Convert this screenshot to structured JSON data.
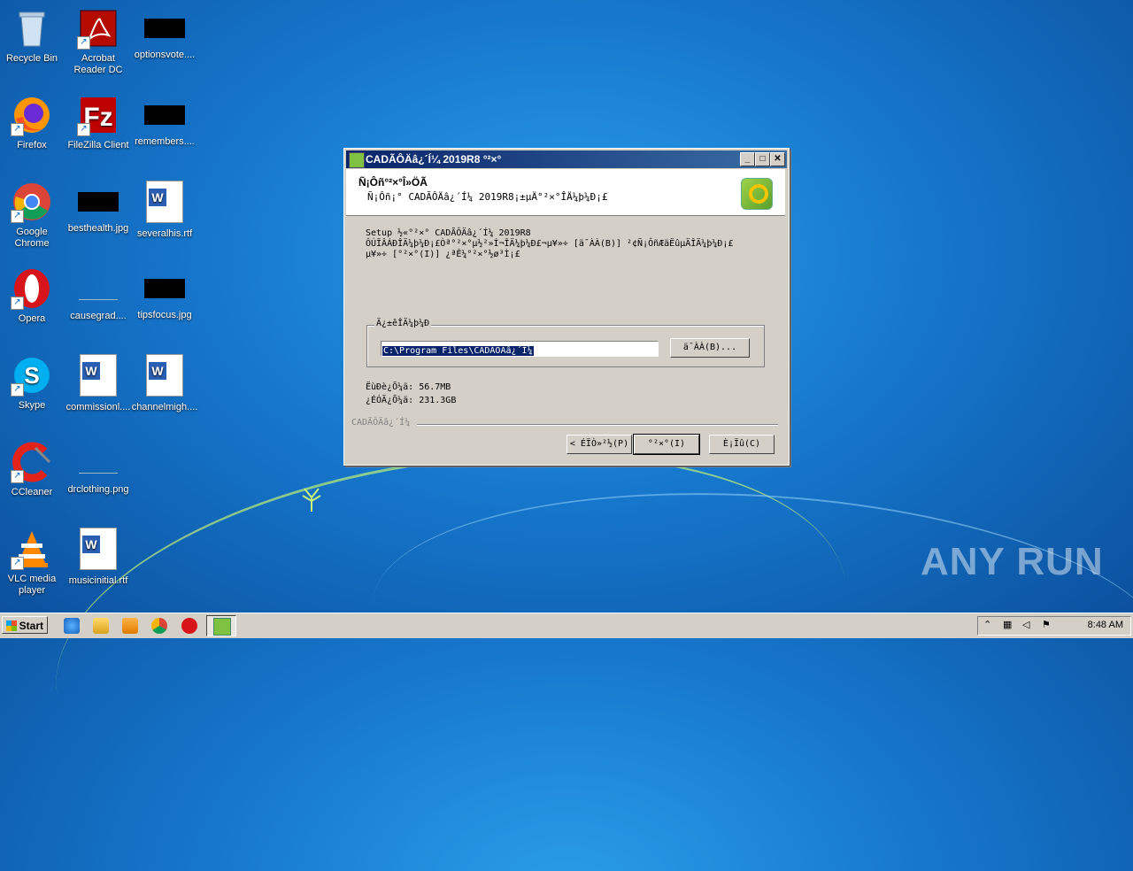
{
  "desktop": {
    "icons": [
      {
        "label": "Recycle Bin"
      },
      {
        "label": "Acrobat Reader DC"
      },
      {
        "label": "optionsvote...."
      },
      {
        "label": "Firefox"
      },
      {
        "label": "FileZilla Client"
      },
      {
        "label": "remembers...."
      },
      {
        "label": "Google Chrome"
      },
      {
        "label": "besthealth.jpg"
      },
      {
        "label": "severalhis.rtf"
      },
      {
        "label": "Opera"
      },
      {
        "label": "causegrad...."
      },
      {
        "label": "tipsfocus.jpg"
      },
      {
        "label": "Skype"
      },
      {
        "label": "commissionl...."
      },
      {
        "label": "channelmigh...."
      },
      {
        "label": "CCleaner"
      },
      {
        "label": "drclothing.png"
      },
      {
        "label": "VLC media player"
      },
      {
        "label": "musicinitial.rtf"
      }
    ],
    "watermark": "ANY RUN"
  },
  "dialog": {
    "title": "CADÃÔÄâ¿´Í¼ 2019R8 °²×°",
    "header_title": "Ñ¡Ôñ°²×°Î»ÖÃ",
    "header_subtitle": "Ñ¡Ôñ¡° CADÃÔÄâ¿´Í¼ 2019R8¡±µÄ°²×°ÎÄ¼þ¼Ð¡£",
    "body_text": "Setup ½«°²×° CADÃÔÄâ¿´Í¼ 2019R8\nÔÚÏÂÁÐÎÄ¼þ¼Ð¡£Òª°²×°µ½²»Í¬ÎÄ¼þ¼Ð£¬µ¥»÷ [ä¯ÀÀ(B)] ²¢Ñ¡ÔñÆäËûµÄÎÄ¼þ¼Ð¡£\nµ¥»÷ [°²×°(I)] ¿ªÊ¼°²×°½ø³Ì¡£",
    "group_legend": "Ä¿±êÎÄ¼þ¼Ð",
    "install_path": "C:\\Program Files\\CADÃÔÄâ¿´Í¼",
    "browse_label": "ä¯ÀÀ(B)...",
    "space_required": "ËùÐè¿Õ¼ä: 56.7MB",
    "space_available": "¿ÉÓÃ¿Õ¼ä: 231.3GB",
    "brand_text": "CADÃÔÄâ¿´Í¼",
    "back_label": "< ÉÏÒ»²½(P)",
    "install_label": "°²×°(I)",
    "cancel_label": "È¡Ïû(C)",
    "minimize_glyph": "_",
    "maximize_glyph": "□",
    "close_glyph": "✕"
  },
  "taskbar": {
    "start_label": "Start",
    "clock": "8:48 AM"
  }
}
